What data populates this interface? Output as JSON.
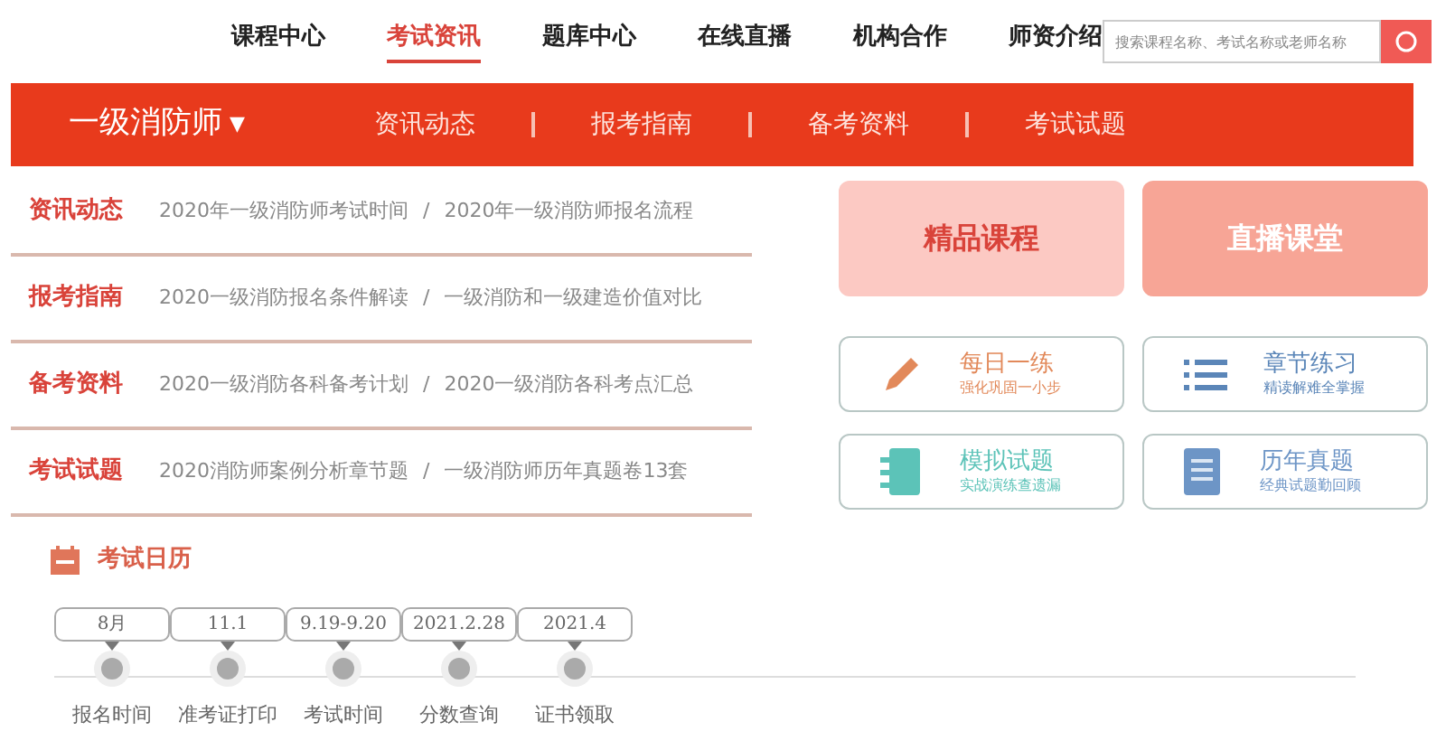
{
  "nav": {
    "items": [
      {
        "label": "课程中心",
        "selected": false
      },
      {
        "label": "考试资讯",
        "selected": true
      },
      {
        "label": "题库中心",
        "selected": false
      },
      {
        "label": "在线直播",
        "selected": false
      },
      {
        "label": "机构合作",
        "selected": false
      },
      {
        "label": "师资介绍",
        "selected": false
      }
    ],
    "search": {
      "placeholder": "搜索课程名称、考试名称或老师名称"
    }
  },
  "banner": {
    "title": "一级消防师",
    "caret": "▼",
    "items": [
      "资讯动态",
      "报考指南",
      "备考资料",
      "考试试题"
    ]
  },
  "news": [
    {
      "category": "资讯动态",
      "link_1": "2020年一级消防师考试时间",
      "separator": "/",
      "link_2": "2020年一级消防师报名流程"
    },
    {
      "category": "报考指南",
      "link_1": "2020一级消防报名条件解读",
      "separator": "/",
      "link_2": "一级消防和一级建造价值对比"
    },
    {
      "category": "备考资料",
      "link_1": "2020一级消防各科备考计划",
      "separator": "/",
      "link_2": "2020一级消防各科考点汇总"
    },
    {
      "category": "考试试题",
      "link_1": "2020消防师案例分析章节题",
      "separator": "/",
      "link_2": "一级消防师历年真题卷13套"
    }
  ],
  "features": [
    {
      "title": "精品课程",
      "color": "#fcc9c3"
    },
    {
      "title": "直播课堂",
      "color": "#f7a596"
    }
  ],
  "tools": [
    {
      "kind": "pencil",
      "title": "每日一练",
      "subtitle": "强化巩固一小步",
      "color": "#e2895a"
    },
    {
      "kind": "list",
      "title": "章节练习",
      "subtitle": "精读解难全掌握",
      "color": "#5b86b8"
    },
    {
      "kind": "notebook",
      "title": "模拟试题",
      "subtitle": "实战演练查遗漏",
      "color": "#5cc3b8"
    },
    {
      "kind": "document",
      "title": "历年真题",
      "subtitle": "经典试题勤回顾",
      "color": "#6d95c6"
    }
  ],
  "calendar": {
    "title": "考试日历",
    "events": [
      {
        "date": "8月",
        "label": "报名时间"
      },
      {
        "date": "11.1",
        "label": "准考证打印"
      },
      {
        "date": "9.19-9.20",
        "label": "考试时间"
      },
      {
        "date": "2021.2.28",
        "label": "分数查询"
      },
      {
        "date": "2021.4",
        "label": "证书领取"
      }
    ]
  }
}
